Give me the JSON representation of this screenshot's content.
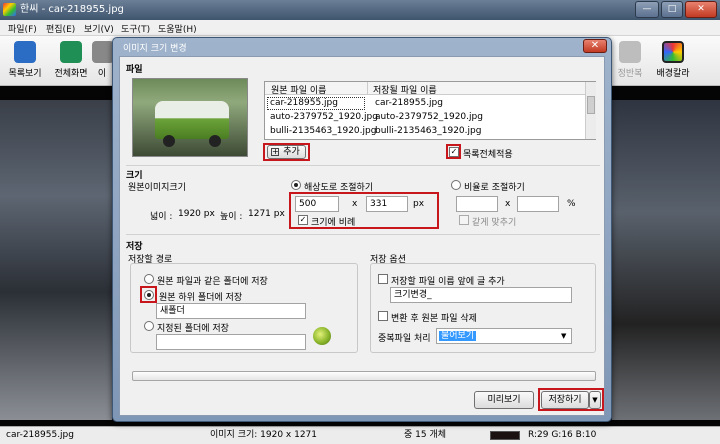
{
  "window": {
    "title": "한씨 - car-218955.jpg",
    "min_label": "—",
    "max_label": "□",
    "close_label": "✕"
  },
  "menu": [
    "파일(F)",
    "편집(E)",
    "보기(V)",
    "도구(T)",
    "도움말(H)"
  ],
  "toolbar": {
    "left": [
      {
        "label": "목록보기",
        "icon": "list-view-icon",
        "color": "#2b6cc4"
      },
      {
        "label": "전체화면",
        "icon": "fullscreen-icon",
        "color": "#1f8f55"
      },
      {
        "label": "이",
        "icon": "image-icon",
        "color": "#888888"
      }
    ],
    "right": [
      {
        "label": "정반복",
        "icon": "repeat-icon",
        "color": "#9a9a9a"
      },
      {
        "label": "배경칼라",
        "icon": "palette-icon",
        "color": "#222222"
      }
    ]
  },
  "dialog": {
    "title": "이미지 크기 변경",
    "close_label": "✕",
    "file": {
      "section_label": "파일",
      "col_original": "원본 파일 이름",
      "col_saved": "저장될 파일 이름",
      "rows": [
        {
          "original": "car-218955.jpg",
          "saved": "car-218955.jpg",
          "selected": true
        },
        {
          "original": "auto-2379752_1920.jpg",
          "saved": "auto-2379752_1920.jpg",
          "selected": false
        },
        {
          "original": "bulli-2135463_1920.jpg",
          "saved": "bulli-2135463_1920.jpg",
          "selected": false
        }
      ],
      "add_button": "추가",
      "apply_all_label": "목록전체적용",
      "apply_all_checked": true
    },
    "size": {
      "section_label": "크기",
      "original_size_label": "원본이미지크기",
      "width_label": "넓이 :",
      "width_value": "1920 px",
      "height_label": "높이 :",
      "height_value": "1271 px",
      "by_resolution_label": "해상도로 조절하기",
      "width_input": "500",
      "times": "x",
      "height_input": "331",
      "unit_px": "px",
      "proportional_label": "크기에 비례",
      "proportional_checked": true,
      "by_ratio_label": "비율로 조절하기",
      "ratio_times": "x",
      "unit_percent": "%",
      "same_label": "같게 맞추기"
    },
    "save": {
      "section_label": "저장",
      "path_group_label": "저장할 경로",
      "same_folder_label": "원본 파일과 같은 폴더에 저장",
      "subfolder_label": "원본 하위 폴더에 저장",
      "subfolder_value": "새폴더",
      "specified_folder_label": "지정된 폴더에 저장",
      "specified_folder_value": "",
      "options_group_label": "저장 옵션",
      "prefix_label": "저장할 파일 이름 앞에 글 추가",
      "prefix_checked": false,
      "prefix_value": "크기변경_",
      "delete_original_label": "변환 후 원본 파일 삭제",
      "delete_original_checked": false,
      "duplicate_label": "중복파일 처리",
      "duplicate_value": "물어보기"
    },
    "progress": 0,
    "preview_button": "미리보기",
    "save_button": "저장하기",
    "dropdown_arrow": "▼"
  },
  "status": {
    "filename": "car-218955.jpg",
    "image_size": "이미지 크기: 1920 x 1271",
    "count": "중 15 개체",
    "color_swatch": "#1a1110",
    "rgb": "R:29 G:16 B:10"
  }
}
